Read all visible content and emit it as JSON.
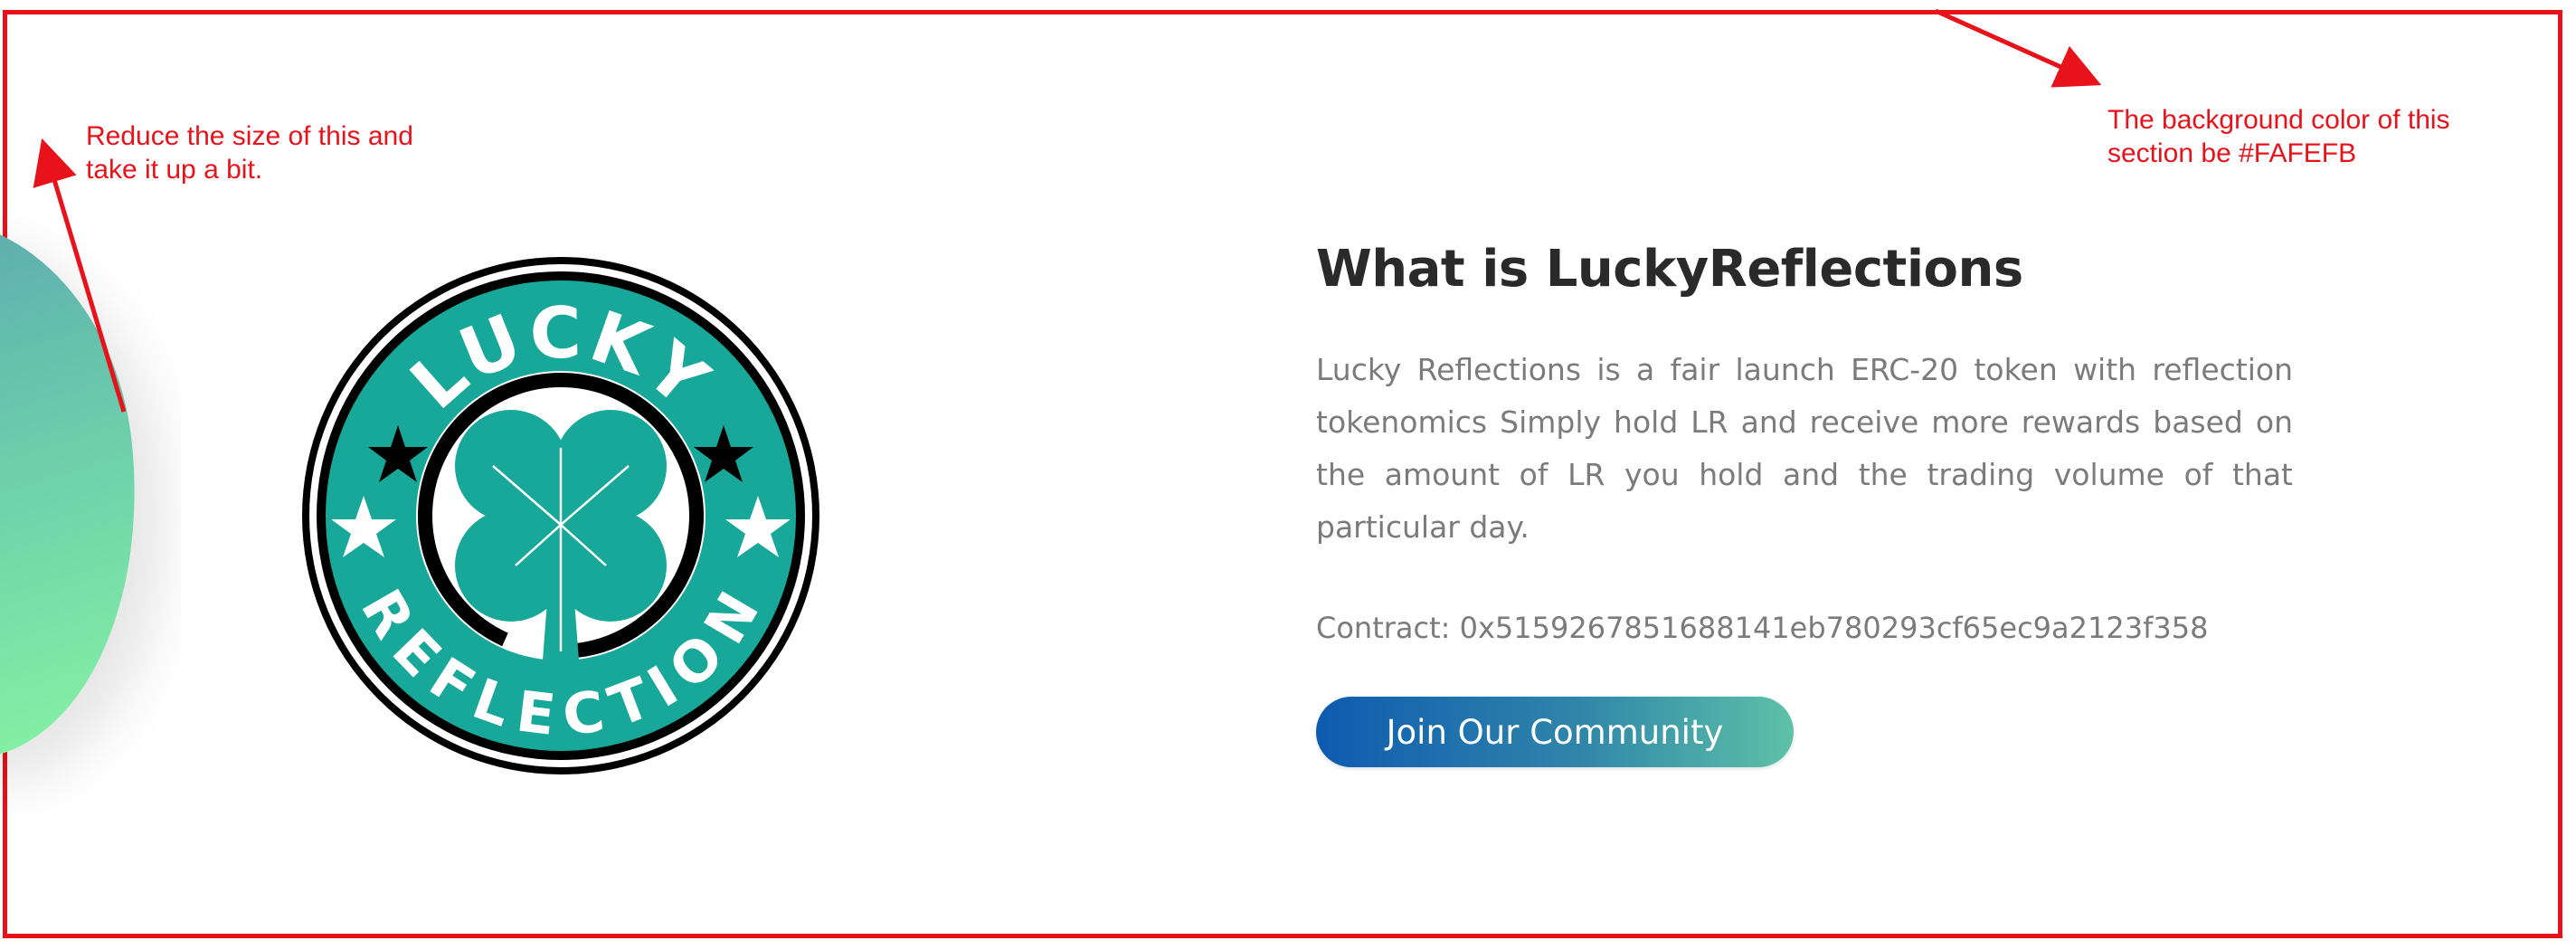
{
  "annotations": {
    "left_note": "Reduce the size of this and\ntake it up a bit.",
    "right_note": "The background color of this\nsection be #FAFEFB",
    "color": "#e8121a"
  },
  "logo": {
    "top_text": "LUCKY",
    "bottom_text": "REFLECTION",
    "icon": "four-leaf-clover-icon",
    "colors": {
      "ring": "#17a89a",
      "outline": "#000000",
      "stars": "#ffffff"
    }
  },
  "about": {
    "heading": "What is LuckyReflections",
    "description": "Lucky Reflections is a fair launch ERC-20 token with reflection tokenomics Simply hold LR and receive more rewards based on the amount of LR you hold and the trading volume of that particular day.",
    "contract": "Contract: 0x5159267851688141eb780293cf65ec9a2123f358",
    "cta_label": "Join Our Community"
  },
  "colors": {
    "accent_gradient": [
      "#0d5bb0",
      "#5ec1a8"
    ],
    "heading": "#2a2a2a",
    "body_text": "#7b7b7b"
  }
}
